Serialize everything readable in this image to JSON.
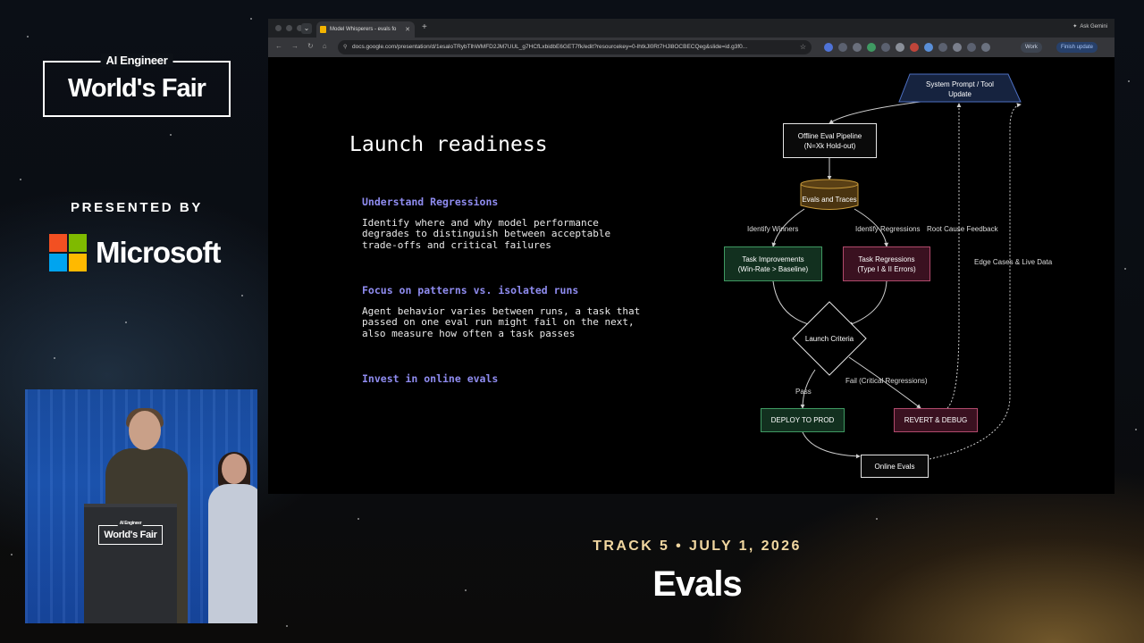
{
  "branding": {
    "event_small": "AI Engineer",
    "event_name": "World's Fair",
    "presented_by": "PRESENTED BY",
    "sponsor": "Microsoft"
  },
  "stage": {
    "track_line": "TRACK 5 • JULY 1, 2026",
    "session_title": "Evals",
    "podium_small": "AI Engineer",
    "podium_sign": "World's Fair"
  },
  "browser": {
    "tab_title": "Model Whisperers - evals fo",
    "url": "docs.google.com/presentation/d/1esaloTRybTlhWMFD2JM7UUL_g7HCfLxbidbE6GET7fk/edit?resourcekey=0-lhtkJl0Rt7HJl8OCBECQeg&slide=id.g3f0...",
    "ask_gemini": "Ask Gemini",
    "profile_label": "Work",
    "finish_update": "Finish update"
  },
  "slide": {
    "title": "Launch readiness",
    "sections": [
      {
        "heading": "Understand Regressions",
        "body": "Identify where and why model performance degrades to distinguish between acceptable trade-offs and critical failures"
      },
      {
        "heading": "Focus on patterns vs. isolated runs",
        "body": "Agent behavior varies between runs, a task that passed on one eval run might fail on the next, also measure how often a task passes"
      },
      {
        "heading": "Invest in online evals",
        "body": ""
      }
    ]
  },
  "flowchart": {
    "nodes": {
      "system_prompt": "System Prompt / Tool\nUpdate",
      "offline_eval": "Offline Eval Pipeline\n(N=Xk Hold-out)",
      "evals_traces": "Evals and Traces",
      "task_improvements": "Task Improvements\n(Win-Rate > Baseline)",
      "task_regressions": "Task Regressions\n(Type I & II Errors)",
      "launch_criteria": "Launch Criteria",
      "deploy": "DEPLOY TO PROD",
      "revert": "REVERT & DEBUG",
      "online_evals": "Online Evals"
    },
    "edge_labels": {
      "identify_winners": "Identify Winners",
      "identify_regressions": "Identify Regressions",
      "root_cause": "Root Cause Feedback",
      "edge_cases": "Edge Cases & Live Data",
      "pass": "Pass",
      "fail": "Fail (Critical Regressions)"
    },
    "colors": {
      "system_prompt_fill": "#16233f",
      "system_prompt_border": "#4d6fc2",
      "improvements_fill": "#12301f",
      "improvements_border": "#3f9a62",
      "regressions_fill": "#3a1120",
      "regressions_border": "#b14a6c",
      "evals_traces_fill": "#4a3410",
      "evals_traces_border": "#c89a3a",
      "edge_color": "#cfcfcf"
    }
  },
  "colors": {
    "track_text": "#f1d7a0",
    "slide_heading": "#8f8cf0",
    "ms_red": "#f25022",
    "ms_green": "#7fba00",
    "ms_blue": "#00a4ef",
    "ms_yellow": "#ffb900"
  }
}
